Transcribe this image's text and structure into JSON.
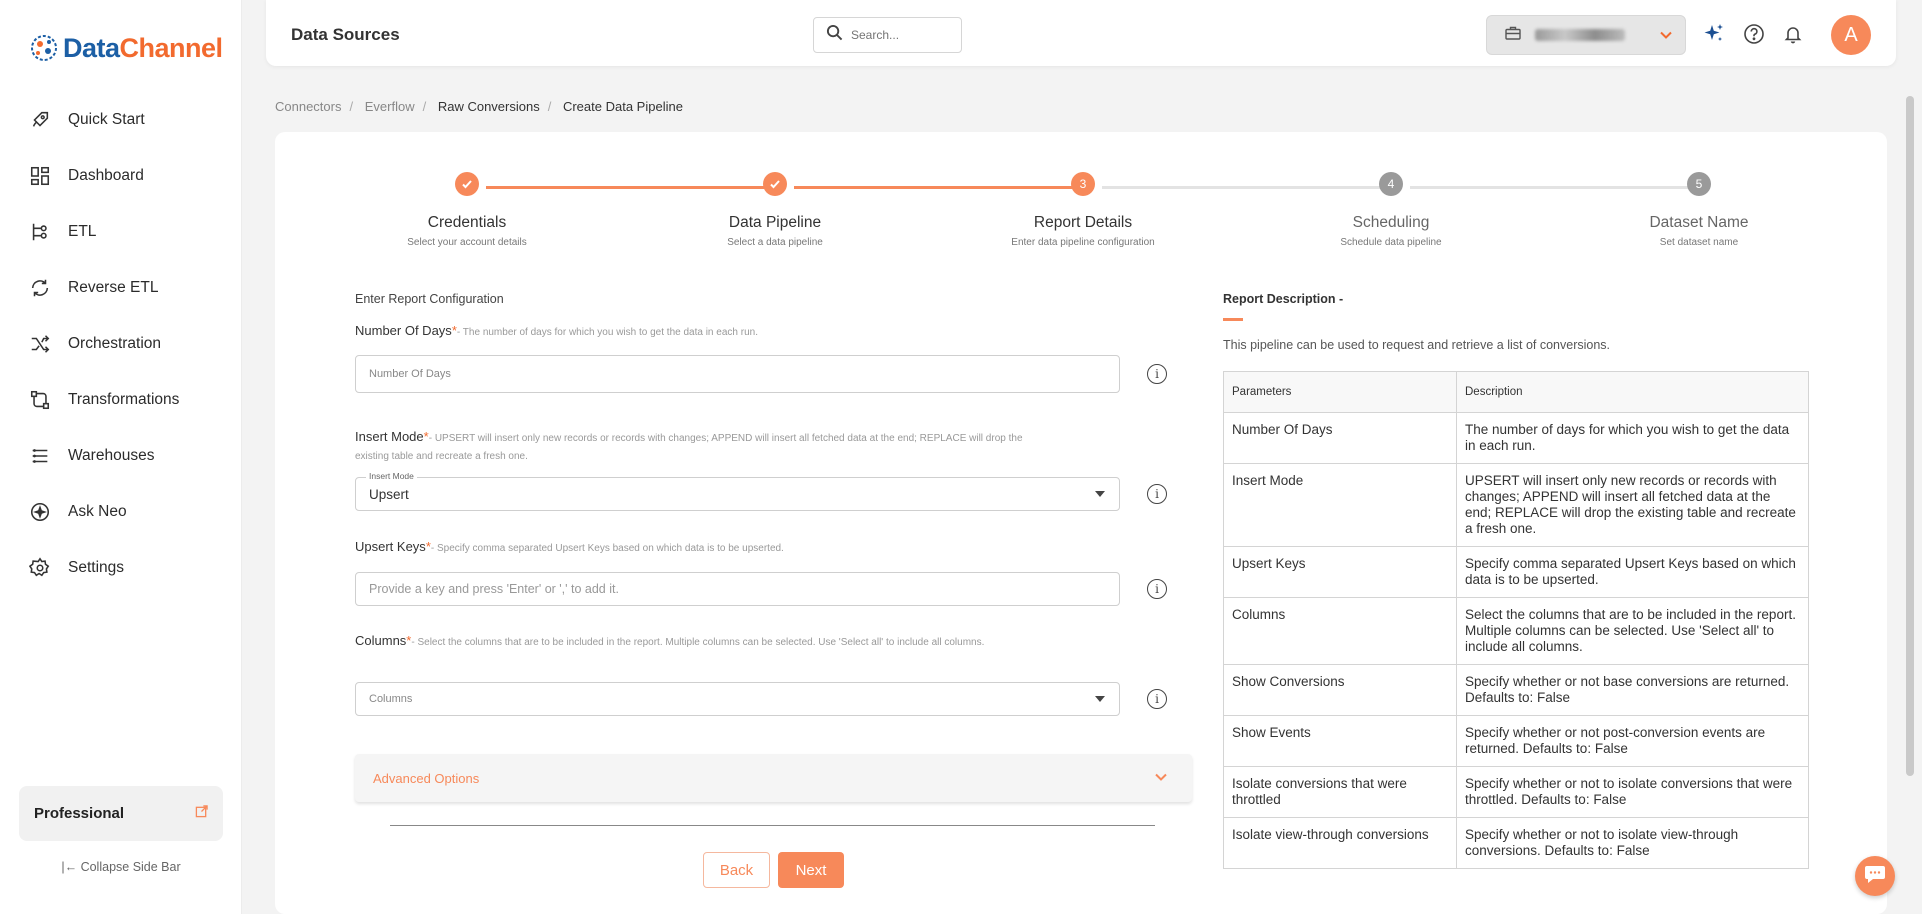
{
  "brand": {
    "name_part1": "Data",
    "name_part2": "Channel"
  },
  "sidebar": {
    "items": [
      {
        "label": "Quick Start",
        "icon": "rocket-icon"
      },
      {
        "label": "Dashboard",
        "icon": "dashboard-icon"
      },
      {
        "label": "ETL",
        "icon": "etl-icon"
      },
      {
        "label": "Reverse ETL",
        "icon": "reverse-etl-icon"
      },
      {
        "label": "Orchestration",
        "icon": "orchestration-icon"
      },
      {
        "label": "Transformations",
        "icon": "transformations-icon"
      },
      {
        "label": "Warehouses",
        "icon": "warehouses-icon"
      },
      {
        "label": "Ask Neo",
        "icon": "ask-neo-icon"
      },
      {
        "label": "Settings",
        "icon": "gear-icon"
      }
    ],
    "plan": "Professional",
    "collapse_label": "Collapse Side Bar"
  },
  "header": {
    "title": "Data Sources",
    "search_placeholder": "Search...",
    "avatar_initial": "A"
  },
  "breadcrumb": [
    "Connectors",
    "Everflow",
    "Raw Conversions",
    "Create Data Pipeline"
  ],
  "stepper": [
    {
      "title": "Credentials",
      "subtitle": "Select your account details",
      "state": "done",
      "num": "1"
    },
    {
      "title": "Data Pipeline",
      "subtitle": "Select a data pipeline",
      "state": "done",
      "num": "2"
    },
    {
      "title": "Report Details",
      "subtitle": "Enter data pipeline configuration",
      "state": "active",
      "num": "3"
    },
    {
      "title": "Scheduling",
      "subtitle": "Schedule data pipeline",
      "state": "todo",
      "num": "4"
    },
    {
      "title": "Dataset Name",
      "subtitle": "Set dataset name",
      "state": "todo",
      "num": "5"
    }
  ],
  "form": {
    "section_title": "Enter Report Configuration",
    "days": {
      "label": "Number Of Days",
      "req": "*",
      "help": "- The number of days for which you wish to get the data in each run.",
      "placeholder": "Number Of Days"
    },
    "insert_mode": {
      "label": "Insert Mode",
      "req": "*",
      "help": "- UPSERT will insert only new records or records with changes; APPEND will insert all fetched data at the end; REPLACE will drop the existing table and recreate a fresh one.",
      "float_label": "Insert Mode",
      "value": "Upsert"
    },
    "upsert_keys": {
      "label": "Upsert Keys",
      "req": "*",
      "help": "- Specify comma separated Upsert Keys based on which data is to be upserted.",
      "placeholder": "Provide a key and press 'Enter' or ',' to add it."
    },
    "columns": {
      "label": "Columns",
      "req": "*",
      "help": "- Select the columns that are to be included in the report. Multiple columns can be selected. Use 'Select all' to include all columns.",
      "placeholder": "Columns"
    },
    "advanced_label": "Advanced Options",
    "back_label": "Back",
    "next_label": "Next"
  },
  "report": {
    "title": "Report Description -",
    "description": "This pipeline can be used to request and retrieve a list of conversions.",
    "headers": [
      "Parameters",
      "Description"
    ],
    "rows": [
      {
        "param": "Number Of Days",
        "desc": "The number of days for which you wish to get the data in each run."
      },
      {
        "param": "Insert Mode",
        "desc": "UPSERT will insert only new records or records with changes; APPEND will insert all fetched data at the end; REPLACE will drop the existing table and recreate a fresh one."
      },
      {
        "param": "Upsert Keys",
        "desc": "Specify comma separated Upsert Keys based on which data is to be upserted."
      },
      {
        "param": "Columns",
        "desc": "Select the columns that are to be included in the report. Multiple columns can be selected. Use 'Select all' to include all columns."
      },
      {
        "param": "Show Conversions",
        "desc": "Specify whether or not base conversions are returned. Defaults to: False"
      },
      {
        "param": "Show Events",
        "desc": "Specify whether or not post-conversion events are returned. Defaults to: False"
      },
      {
        "param": "Isolate conversions that were throttled",
        "desc": "Specify whether or not to isolate conversions that were throttled. Defaults to: False"
      },
      {
        "param": "Isolate view-through conversions",
        "desc": "Specify whether or not to isolate view-through conversions. Defaults to: False"
      }
    ]
  },
  "colors": {
    "accent": "#f7895a",
    "brand_blue": "#1c5fa5",
    "step_todo": "#9a9a9a"
  }
}
